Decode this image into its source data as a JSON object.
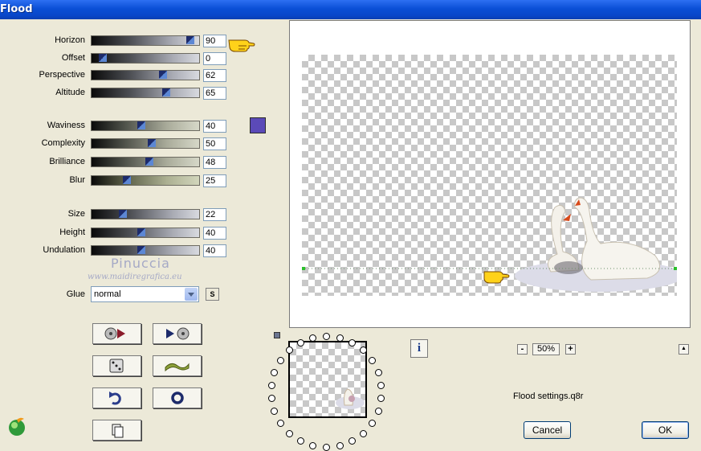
{
  "window": {
    "title": "Flood"
  },
  "params": [
    {
      "label": "Horizon",
      "value": "90"
    },
    {
      "label": "Offset",
      "value": "0"
    },
    {
      "label": "Perspective",
      "value": "62"
    },
    {
      "label": "Altitude",
      "value": "65"
    },
    {
      "label": "Waviness",
      "value": "40"
    },
    {
      "label": "Complexity",
      "value": "50"
    },
    {
      "label": "Brilliance",
      "value": "48"
    },
    {
      "label": "Blur",
      "value": "25"
    },
    {
      "label": "Size",
      "value": "22"
    },
    {
      "label": "Height",
      "value": "40"
    },
    {
      "label": "Undulation",
      "value": "40"
    }
  ],
  "glue": {
    "label": "Glue",
    "value": "normal",
    "s_button": "S"
  },
  "watermark": {
    "name": "Pinuccia",
    "site": "www.maidiregrafica.eu"
  },
  "colors": {
    "swatch": "#5b4ab8",
    "titlebar": "#0a4fd6"
  },
  "zoom": {
    "value": "50%",
    "minus": "-",
    "plus": "+"
  },
  "info_button": "i",
  "collapse_button": "▲",
  "status_text": "Flood settings.q8r",
  "buttons": {
    "cancel": "Cancel",
    "ok": "OK"
  }
}
